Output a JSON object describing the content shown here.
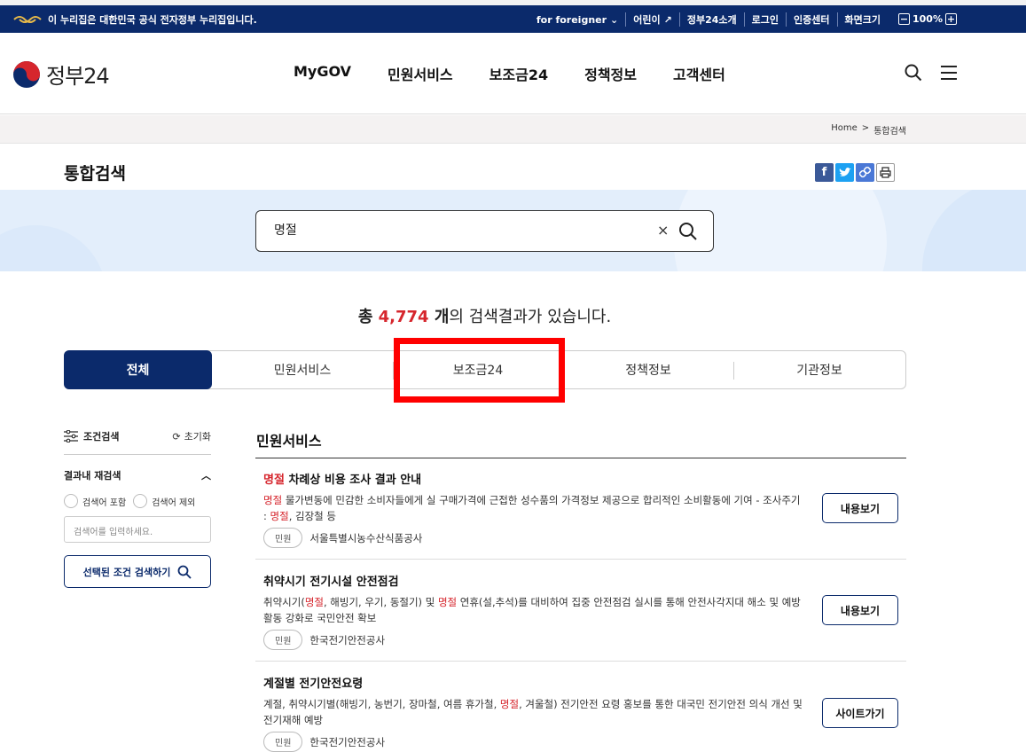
{
  "topbar": {
    "gov_notice": "이 누리집은 대한민국 공식 전자정부 누리집입니다.",
    "links": [
      "for foreigner",
      "어린이",
      "정부24소개",
      "로그인",
      "인증센터"
    ],
    "zoom_label": "화면크기",
    "zoom_value": "100%",
    "zoom_minus": "−",
    "zoom_plus": "+"
  },
  "header": {
    "logo_text": "정부24",
    "nav": [
      "MyGOV",
      "민원서비스",
      "보조금24",
      "정책정보",
      "고객센터"
    ]
  },
  "breadcrumb": {
    "home": "Home",
    "sep": ">",
    "current": "통합검색"
  },
  "page": {
    "title": "통합검색"
  },
  "search": {
    "value": "명절",
    "clear": "×"
  },
  "results": {
    "prefix": "총 ",
    "count": "4,774",
    "unit": " 개",
    "suffix": "의 검색결과가 있습니다."
  },
  "tabs": [
    "전체",
    "민원서비스",
    "보조금24",
    "정책정보",
    "기관정보"
  ],
  "filter": {
    "title": "조건검색",
    "reset": "초기화",
    "sub_title": "결과내 재검색",
    "radio_include": "검색어 포함",
    "radio_exclude": "검색어 제외",
    "input_placeholder": "검색어를 입력하세요.",
    "search_button": "선택된 조건 검색하기"
  },
  "section": {
    "title": "민원서비스"
  },
  "items": [
    {
      "title_hl": "명절",
      "title_rest": " 차례상 비용 조사 결과 안내",
      "desc": [
        {
          "t": "명절",
          "hl": true
        },
        {
          "t": " 물가변동에 민감한 소비자들에게 실 구매가격에 근접한 성수품의 가격정보 제공으로 합리적인 소비활동에 기여 - 조사주기 : ",
          "hl": false
        },
        {
          "t": "명절",
          "hl": true
        },
        {
          "t": ", 김장철 등",
          "hl": false
        }
      ],
      "badge": "민원",
      "org": "서울특별시농수산식품공사",
      "button": "내용보기"
    },
    {
      "title_hl": "",
      "title_rest": "취약시기 전기시설 안전점검",
      "desc": [
        {
          "t": "취약시기(",
          "hl": false
        },
        {
          "t": "명절",
          "hl": true
        },
        {
          "t": ", 해빙기, 우기, 동절기) 및 ",
          "hl": false
        },
        {
          "t": "명절",
          "hl": true
        },
        {
          "t": " 연휴(설,추석)를 대비하여 집중 안전점검 실시를 통해 안전사각지대 해소 및 예방활동 강화로 국민안전 확보",
          "hl": false
        }
      ],
      "badge": "민원",
      "org": "한국전기안전공사",
      "button": "내용보기"
    },
    {
      "title_hl": "",
      "title_rest": "계절별 전기안전요령",
      "desc": [
        {
          "t": "계절, 취약시기별(해빙기, 농번기, 장마철, 여름 휴가철, ",
          "hl": false
        },
        {
          "t": "명절",
          "hl": true
        },
        {
          "t": ", 겨울철) 전기안전 요령 홍보를 통한 대국민 전기안전 의식 개선 및 전기재해 예방",
          "hl": false
        }
      ],
      "badge": "민원",
      "org": "한국전기안전공사",
      "button": "사이트가기"
    }
  ],
  "colors": {
    "navy": "#0b2a6b",
    "highlight": "#d6262d",
    "annotation": "#ff0000"
  }
}
